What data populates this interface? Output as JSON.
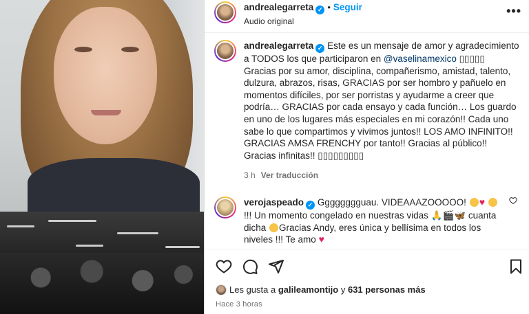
{
  "header": {
    "username": "andrealegarreta",
    "follow_label": "Seguir",
    "subtitle": "Audio original",
    "more_label": "•••"
  },
  "caption": {
    "username": "andrealegarreta",
    "text_1": "Este es un mensaje de amor y agradecimiento a TODOS los que participaron en ",
    "mention": "@vaselinamexico",
    "text_2": " ▯▯▯▯▯ Gracias por su amor, disciplina, compañerismo, amistad, talento, dulzura, abrazos, risas, GRACIAS por ser hombro y pañuelo en momentos difíciles, por ser porristas y ayudarme a creer que podría… GRACIAS por cada ensayo y cada función… Los guardo en uno de los lugares más especiales en mi corazón!! Cada uno sabe lo que compartimos y vivimos juntos!! LOS AMO INFINITO!! GRACIAS AMSA FRENCHY por tanto!! Gracias al público!! Gracias infinitas!! ▯▯▯▯▯▯▯▯▯",
    "time": "3 h",
    "translate_label": "Ver traducción"
  },
  "comment": {
    "username": "verojaspeado",
    "text_1": "Gggggggguau. VIDEAAAZOOOOO!",
    "text_2": "!!! Un momento congelado en nuestras vidas",
    "text_3": "cuanta dicha",
    "text_4": "Gracias Andy, eres única y bellísima en todos los niveles !!! Te amo",
    "like_icon": "heart-outline-icon"
  },
  "likes": {
    "prefix": "Les gusta a ",
    "user": "galileamontijo",
    "middle": " y ",
    "count_text": "631 personas más"
  },
  "timestamp": "Hace 3 horas",
  "colors": {
    "link": "#0095f6",
    "mention": "#00376b",
    "muted": "#737373",
    "verified": "#0095f6"
  }
}
